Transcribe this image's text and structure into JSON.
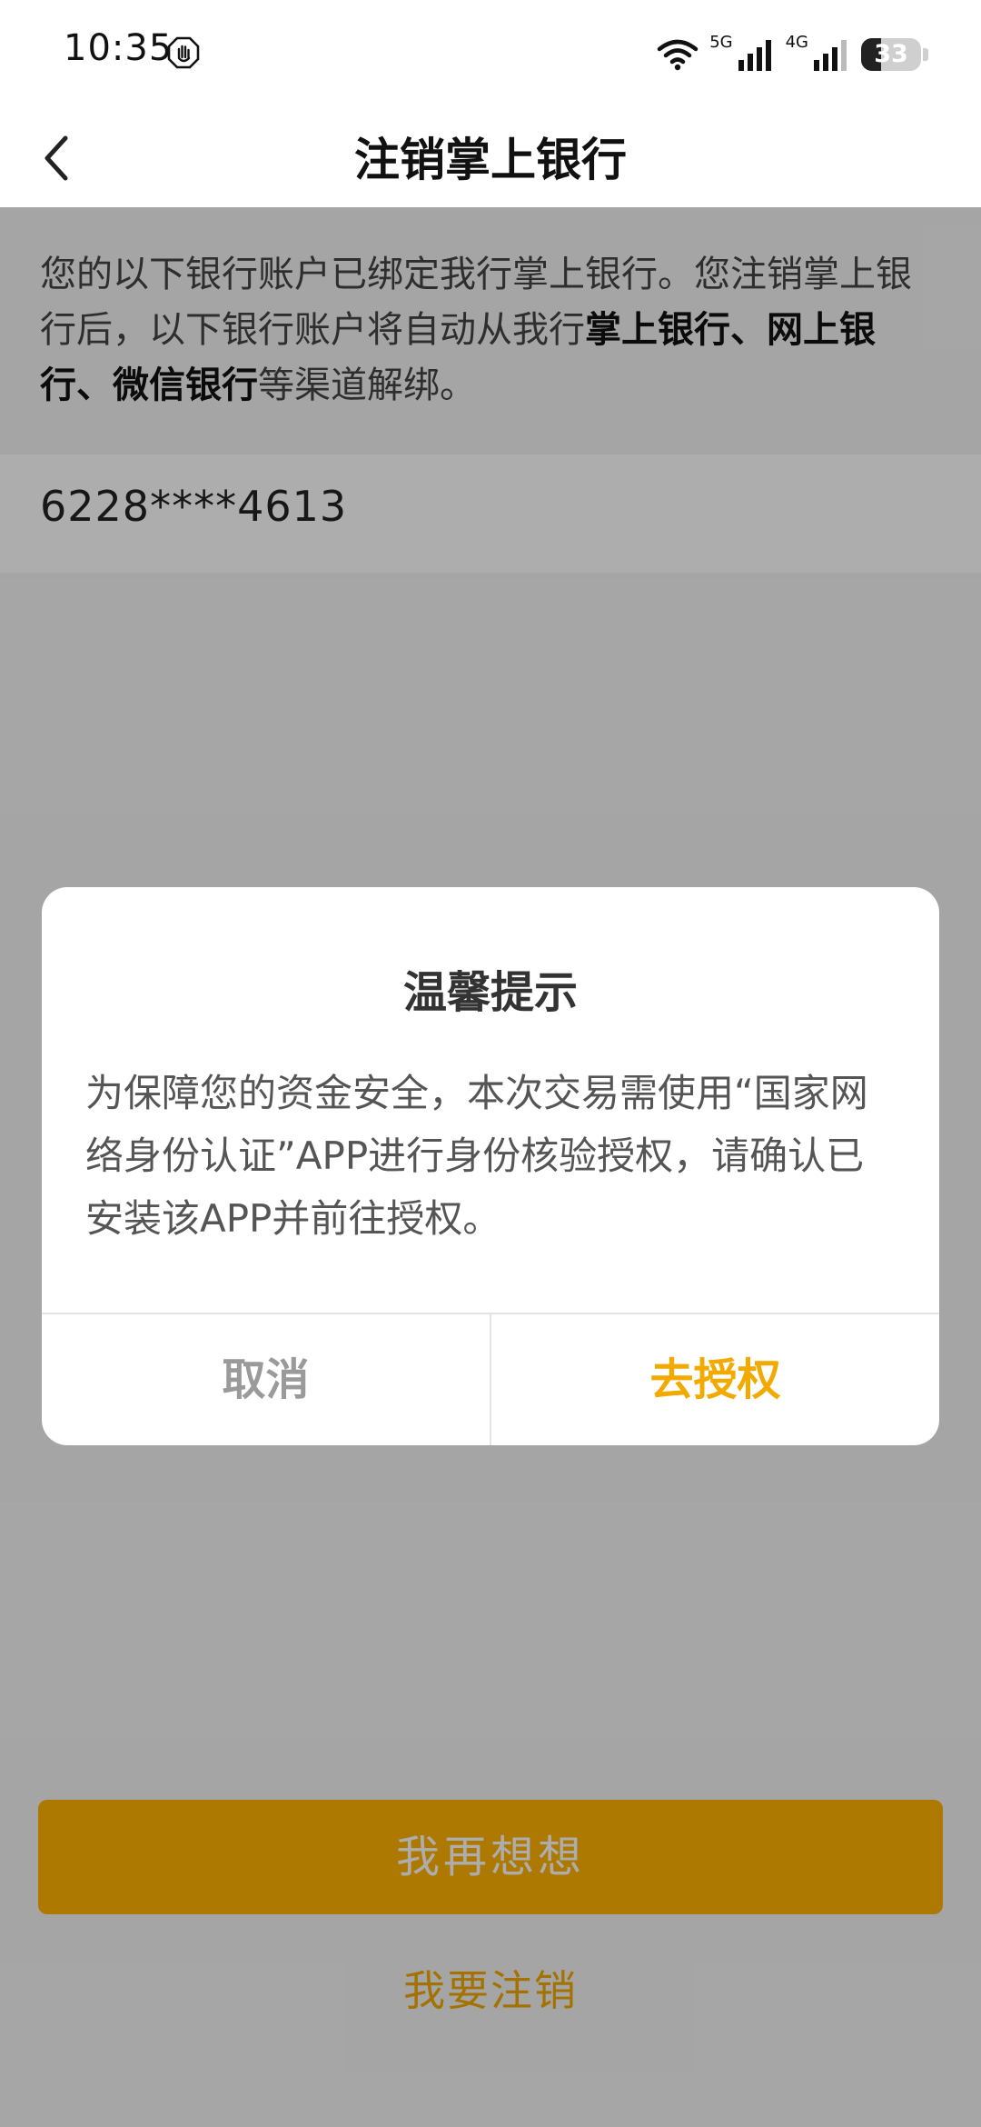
{
  "status_bar": {
    "time": "10:35",
    "network_1": "5G",
    "network_2": "4G",
    "battery_level": "33",
    "battery_fraction": 0.33,
    "icons": [
      "hand-stop-icon",
      "wifi-icon",
      "signal-icon",
      "signal-icon",
      "battery-icon"
    ]
  },
  "header": {
    "back_icon": "chevron-left-icon",
    "title": "注销掌上银行"
  },
  "notice": {
    "text_1": "您的以下银行账户已绑定我行掌上银行。您注销掌上银行后，以下银行账户将自动从我行",
    "bold_1": "掌上银行、网上银行、微信银行",
    "text_2": "等渠道解绑。"
  },
  "account": {
    "number": "6228****4613"
  },
  "actions": {
    "primary_label": "我再想想",
    "secondary_label": "我要注销"
  },
  "dialog": {
    "title": "温馨提示",
    "body": "为保障您的资金安全，本次交易需使用“国家网络身份认证”APP进行身份核验授权，请确认已安装该APP并前往授权。",
    "cancel_label": "取消",
    "confirm_label": "去授权"
  },
  "colors": {
    "accent": "#f2a900",
    "primary_button": "#ffb300",
    "overlay": "rgba(0,0,0,0.32)"
  }
}
